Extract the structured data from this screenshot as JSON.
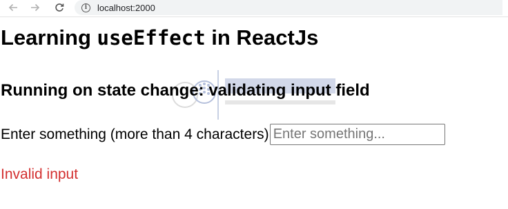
{
  "browser": {
    "back_icon": "arrow-left-icon",
    "forward_icon": "arrow-right-icon",
    "reload_icon": "reload-icon",
    "info_icon": "info-icon",
    "url": "localhost:2000"
  },
  "page": {
    "title_prefix": "Learning ",
    "title_code": "useEffect",
    "title_suffix": " in ReactJs",
    "subtitle": "Running on state change: validating input field",
    "input_label": "Enter something (more than 4 characters)",
    "input_placeholder": "Enter something...",
    "input_value": "",
    "error_message": "Invalid input"
  },
  "colors": {
    "error": "#d32f2f",
    "watermark_blue": "#2a4a9a"
  }
}
